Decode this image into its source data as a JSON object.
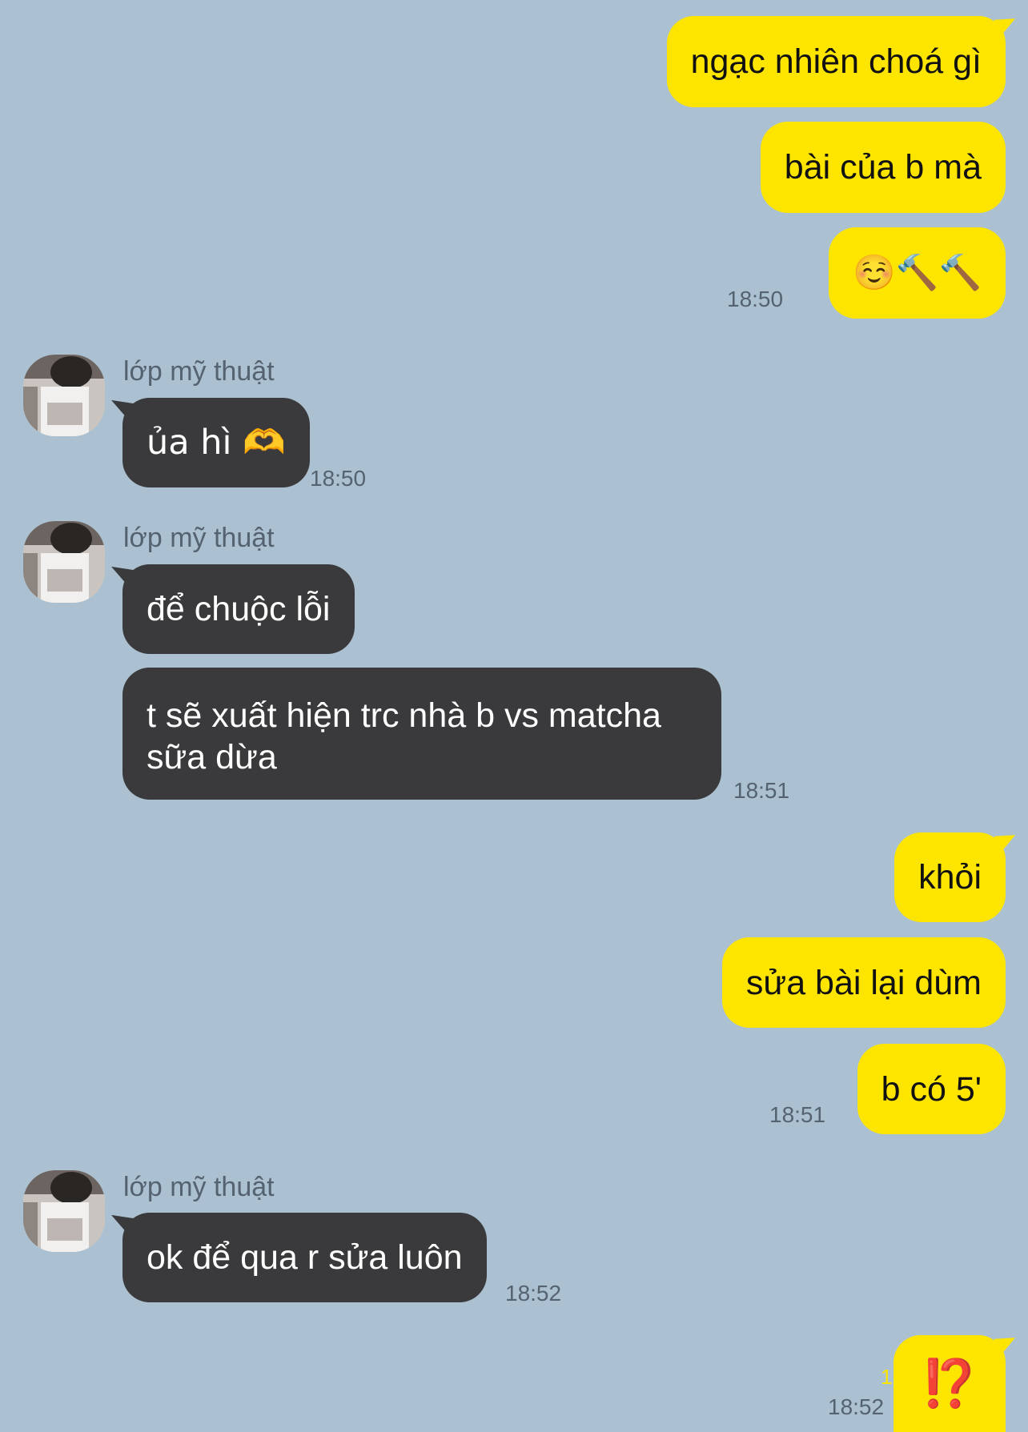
{
  "sender_name": "lớp mỹ thuật",
  "messages": {
    "m1": "ngạc nhiên choá gì",
    "m2": "bài của b mà",
    "m3": "☺️🔨🔨",
    "m4": "ủa hì 🫶",
    "m5": "để chuộc lỗi",
    "m6": "t sẽ xuất hiện trc nhà b vs matcha sữa dừa",
    "m7": "khỏi",
    "m8": "sửa bài lại dùm",
    "m9": "b có 5'",
    "m10": "ok để qua r sửa luôn",
    "m11": "⁉️"
  },
  "times": {
    "t1": "18:50",
    "t2": "18:50",
    "t3": "18:51",
    "t4": "18:51",
    "t5": "18:52",
    "t6": "18:52"
  },
  "unread_count": "1",
  "colors": {
    "background": "#abc1d1",
    "my_bubble": "#fee500",
    "their_bubble": "#3a3a3c"
  }
}
